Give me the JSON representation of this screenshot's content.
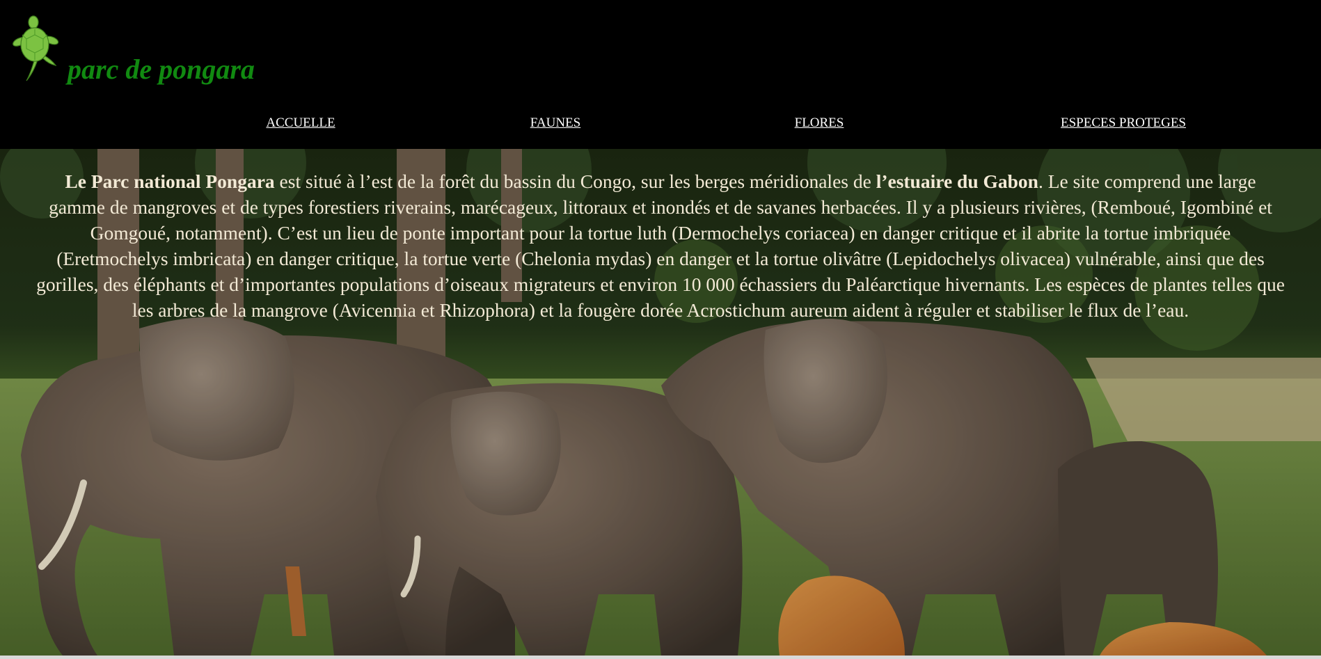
{
  "site": {
    "title": "parc de pongara",
    "logo_icon": "turtle-icon"
  },
  "nav": [
    {
      "label": "ACCUELLE"
    },
    {
      "label": "FAUNES"
    },
    {
      "label": "FLORES"
    },
    {
      "label": "ESPECES PROTEGES"
    }
  ],
  "intro": {
    "bold1": "Le Parc national Pongara",
    "text1": " est situé à l’est de la forêt du bassin du Congo, sur les berges méridionales de ",
    "bold2": "l’estuaire du Gabon",
    "text2": ". Le site comprend une large gamme de mangroves et de types forestiers riverains, marécageux, littoraux et inondés et de savanes herbacées. Il y a plusieurs rivières, (Remboué, Igombiné et Gomgoué, notamment). C’est un lieu de ponte important pour la tortue luth (Dermochelys coriacea) en danger critique et il abrite la tortue imbriquée (Eretmochelys imbricata) en danger critique, la tortue verte (Chelonia mydas) en danger et la tortue olivâtre (Lepidochelys olivacea) vulnérable, ainsi que des gorilles, des éléphants et d’importantes populations d’oiseaux migrateurs et environ 10 000 échassiers du Paléarctique hivernants. Les espèces de plantes telles que les arbres de la mangrove (Avicennia et Rhizophora) et la fougère dorée Acrostichum aureum aident à réguler et stabiliser le flux de l’eau."
  },
  "colors": {
    "header_bg": "#000000",
    "title_green": "#118a11",
    "nav_text": "#ffffff",
    "intro_text": "#f3ead6"
  }
}
